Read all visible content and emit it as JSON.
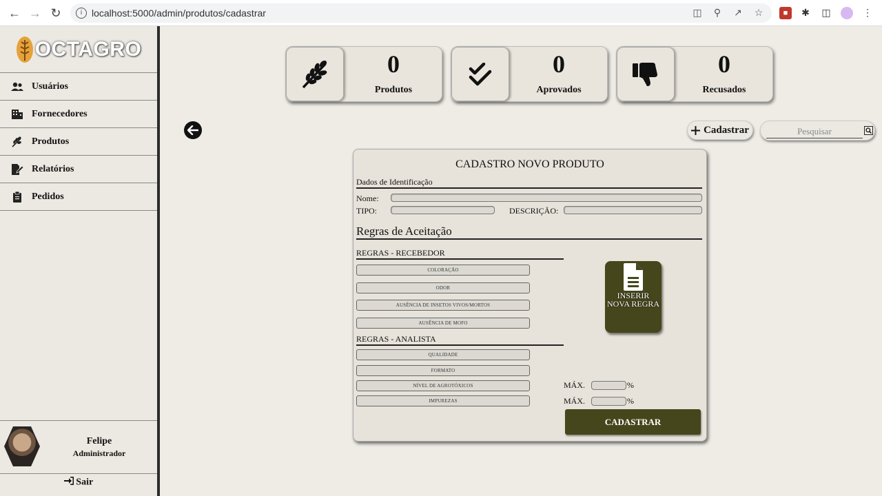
{
  "browser": {
    "url": "localhost:5000/admin/produtos/cadastrar"
  },
  "sidebar": {
    "brand": "OCTAGRO",
    "items": [
      {
        "label": "Usuários",
        "icon": "users-icon"
      },
      {
        "label": "Fornecedores",
        "icon": "building-icon"
      },
      {
        "label": "Produtos",
        "icon": "wheat-icon"
      },
      {
        "label": "Relatórios",
        "icon": "report-icon"
      },
      {
        "label": "Pedidos",
        "icon": "clipboard-icon"
      }
    ],
    "user": {
      "name": "Felipe",
      "role": "Administrador"
    },
    "logout": "Sair"
  },
  "stats": [
    {
      "value": "0",
      "label": "Produtos",
      "icon": "wheat-icon"
    },
    {
      "value": "0",
      "label": "Aprovados",
      "icon": "double-check-icon"
    },
    {
      "value": "0",
      "label": "Recusados",
      "icon": "thumbs-down-icon"
    }
  ],
  "toolbar": {
    "cadastrar_label": "Cadastrar",
    "search_placeholder": "Pesquisar"
  },
  "form": {
    "title": "CADASTRO NOVO PRODUTO",
    "identification_section": "Dados de Identificação",
    "nome_label": "Nome:",
    "nome_value": "",
    "tipo_label": "TIPO:",
    "tipo_value": "",
    "descricao_label": "DESCRIÇÃO:",
    "descricao_value": "",
    "rules_title": "Regras de Aceitação",
    "receiver_section": "REGRAS - RECEBEDOR",
    "receiver_rules": [
      "COLORAÇÃO",
      "ODOR",
      "AUSÊNCIA DE INSETOS VIVOS/MORTOS",
      "AUSÊNCIA DE MOFO"
    ],
    "analyst_section": "REGRAS - ANALISTA",
    "analyst_rules": [
      "QUALIDADE",
      "FORMATO",
      "NÍVEL DE AGROTÓXICOS",
      "IMPUREZAS"
    ],
    "new_rule_label": "INSERIR NOVA REGRA",
    "max_label": "MÁX.",
    "percent": "%",
    "submit_label": "CADASTRAR"
  },
  "colors": {
    "accent": "#46461c",
    "background": "#efece6",
    "sidebar_border": "#2b2b2b"
  }
}
